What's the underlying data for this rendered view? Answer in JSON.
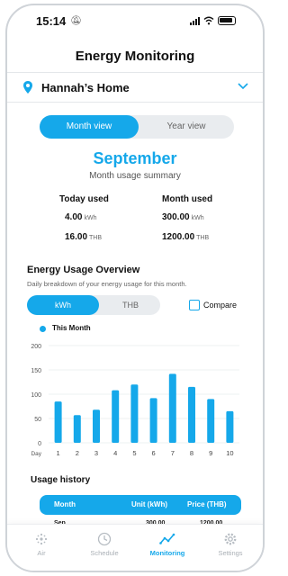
{
  "status": {
    "time": "15:14"
  },
  "header": {
    "title": "Energy Monitoring"
  },
  "location": {
    "name": "Hannah’s Home"
  },
  "view_toggle": {
    "active": "Month view",
    "inactive": "Year view"
  },
  "summary": {
    "month": "September",
    "subtitle": "Month usage summary",
    "today_label": "Today used",
    "month_label": "Month used",
    "today_kwh": "4.00",
    "today_thb": "16.00",
    "month_kwh": "300.00",
    "month_thb": "1200.00",
    "unit_kwh": "kWh",
    "unit_thb": "THB"
  },
  "overview": {
    "title": "Energy Usage Overview",
    "subtitle": "Daily breakdown of your energy usage for this month.",
    "unit_active": "kWh",
    "unit_inactive": "THB",
    "compare_label": "Compare",
    "legend_label": "This Month"
  },
  "chart_data": {
    "type": "bar",
    "x_label_prefix": "Day",
    "categories": [
      "1",
      "2",
      "3",
      "4",
      "5",
      "6",
      "7",
      "8",
      "9",
      "10"
    ],
    "series": [
      {
        "name": "This Month",
        "values": [
          85,
          57,
          68,
          108,
          120,
          92,
          142,
          115,
          90,
          65
        ]
      }
    ],
    "ylim": [
      0,
      200
    ],
    "yticks": [
      "0",
      "50",
      "100",
      "150",
      "200"
    ],
    "color": "#15a8ea",
    "grid": true
  },
  "history": {
    "title": "Usage history",
    "columns": [
      "Month",
      "Unit (kWh)",
      "Price (THB)"
    ],
    "rows": [
      {
        "month": "Sep",
        "unit": "300.00",
        "price": "1200.00"
      }
    ]
  },
  "tabs": [
    {
      "label": "Air",
      "icon": "fan-icon",
      "active": false
    },
    {
      "label": "Schedule",
      "icon": "clock-icon",
      "active": false
    },
    {
      "label": "Monitoring",
      "icon": "chart-line-icon",
      "active": true
    },
    {
      "label": "Settings",
      "icon": "gear-icon",
      "active": false
    }
  ],
  "colors": {
    "accent": "#15a8ea"
  }
}
